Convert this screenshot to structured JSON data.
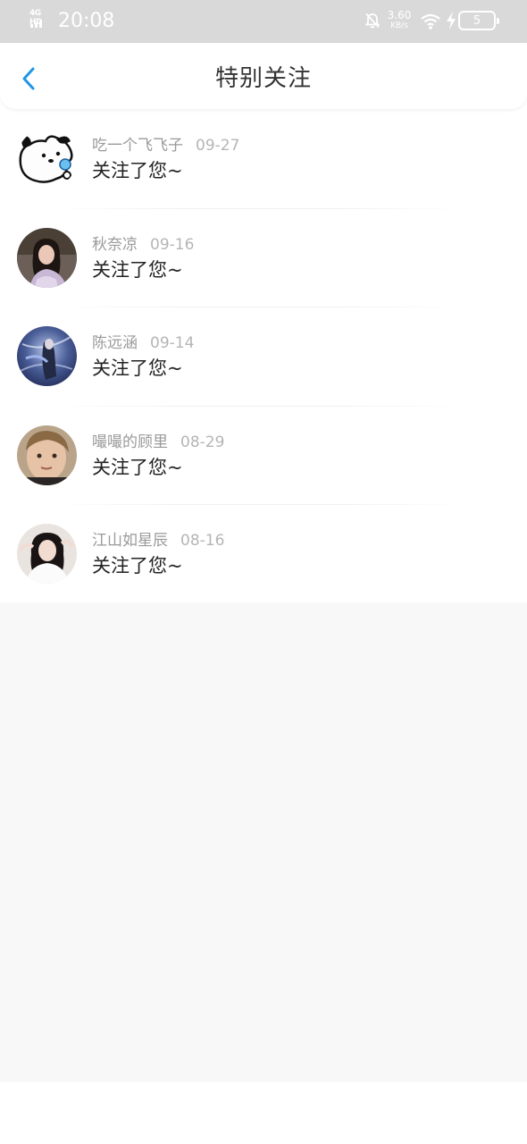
{
  "status_bar": {
    "network": "4G HD",
    "time": "20:08",
    "speed_value": "3.60",
    "speed_unit": "KB/s",
    "battery": "5"
  },
  "header": {
    "title": "特别关注",
    "back_icon": "chevron-left-icon"
  },
  "colors": {
    "accent": "#2196e6",
    "status_bar_bg": "#d9d9d9",
    "empty_area_bg": "#f9f8f8"
  },
  "items": [
    {
      "name": "吃一个飞飞子",
      "date": "09-27",
      "action": "关注了您~"
    },
    {
      "name": "秋奈凉",
      "date": "09-16",
      "action": "关注了您~"
    },
    {
      "name": "陈远涵",
      "date": "09-14",
      "action": "关注了您~"
    },
    {
      "name": "嘬嘬的顾里",
      "date": "08-29",
      "action": "关注了您~"
    },
    {
      "name": "江山如星辰",
      "date": "08-16",
      "action": "关注了您~"
    }
  ]
}
